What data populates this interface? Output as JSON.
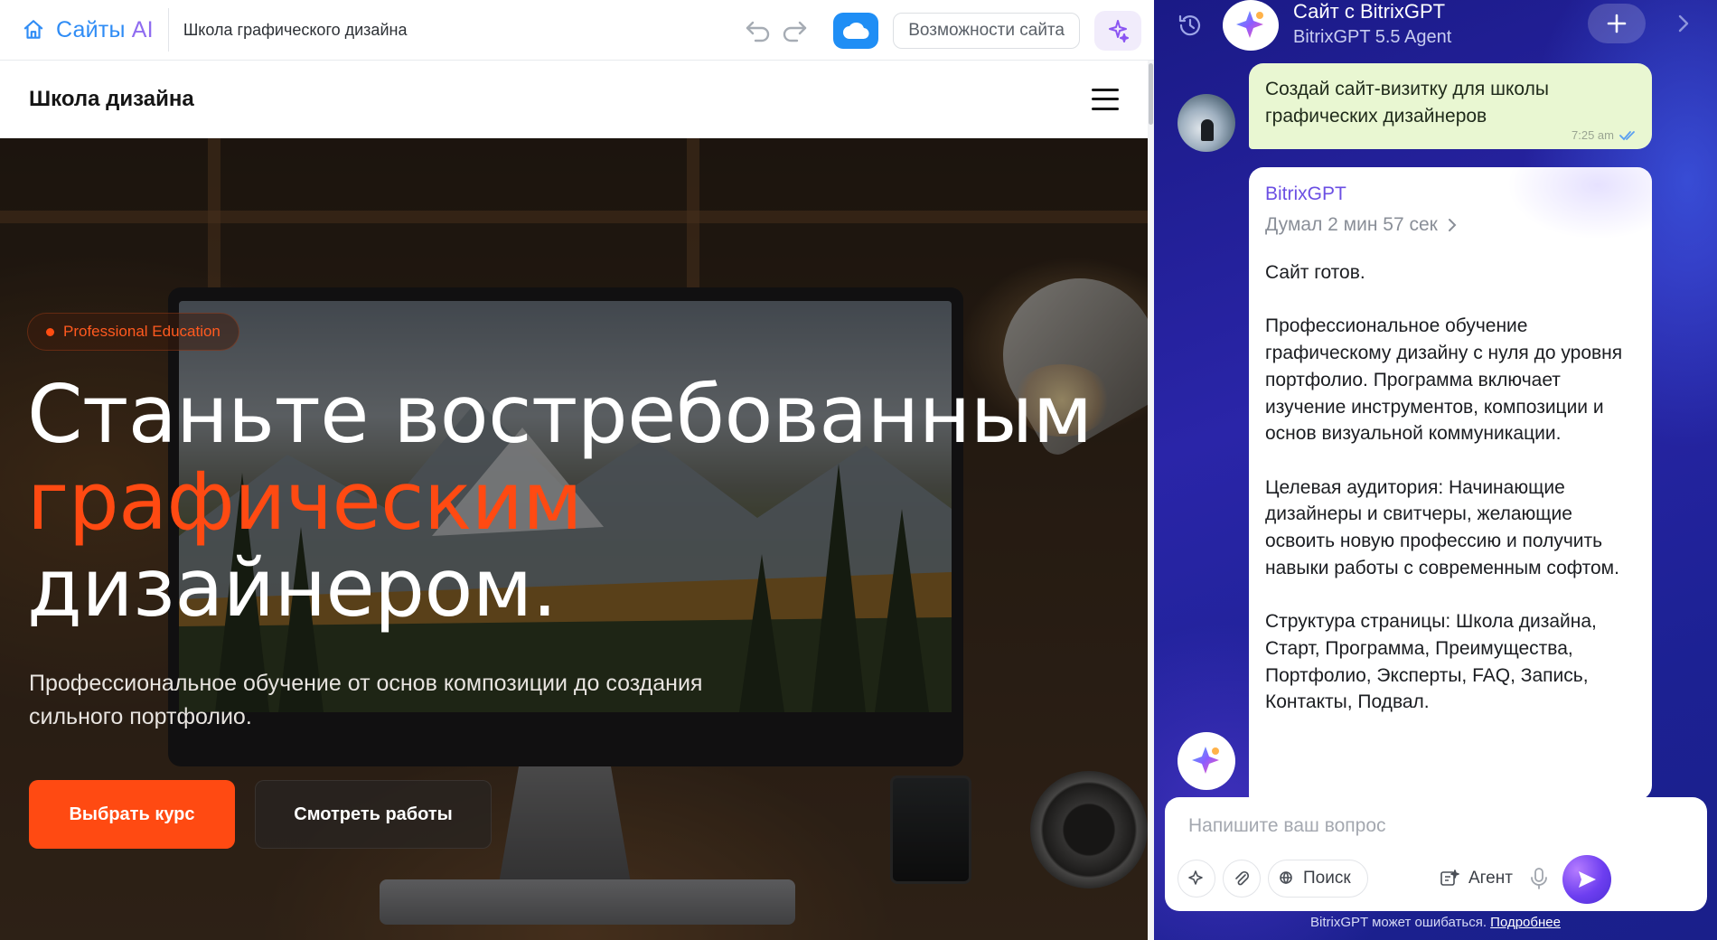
{
  "app": {
    "brand_prefix": "Сайты",
    "brand_suffix": "AI",
    "site_name": "Школа графического дизайна",
    "features_label": "Возможности сайта"
  },
  "site": {
    "logo": "Школа дизайна",
    "badge": "Professional Education",
    "headline_line1": "Станьте востребованным",
    "headline_line2": "графическим",
    "headline_line3": "дизайнером.",
    "subtitle": "Профессиональное обучение от основ композиции до создания сильного портфолио.",
    "cta_primary": "Выбрать курс",
    "cta_secondary": "Смотреть работы",
    "accent_color": "#ff4a12"
  },
  "chat": {
    "title": "Сайт с BitrixGPT",
    "subtitle": "BitrixGPT 5.5 Agent",
    "user_message": "Создай сайт-визитку для школы графических дизайнеров",
    "user_time": "7:25 am",
    "bot_name": "BitrixGPT",
    "bot_thought": "Думал 2 мин 57 сек",
    "bot_paragraphs": [
      "Сайт готов.",
      "Профессиональное обучение графическому дизайну с нуля до уровня портфолио. Программа включает изучение инструментов, композиции и основ визуальной коммуникации.",
      "Целевая аудитория: Начинающие дизайнеры и свитчеры, желающие освоить новую профессию и получить навыки работы с современным софтом.",
      "Структура страницы: Школа дизайна, Старт, Программа, Преимущества, Портфолио, Эксперты, FAQ, Запись, Контакты, Подвал."
    ],
    "input_placeholder": "Напишите ваш вопрос",
    "search_label": "Поиск",
    "agent_label": "Агент",
    "disclaimer": "BitrixGPT может ошибаться.",
    "disclaimer_link": "Подробнее"
  },
  "icons": {
    "home": "home-icon",
    "undo": "undo-icon",
    "redo": "redo-icon",
    "cloud": "cloud-icon",
    "sparkle": "sparkle-icon",
    "history": "history-icon",
    "plus": "plus-icon",
    "send": "send-icon",
    "mic": "mic-icon"
  }
}
